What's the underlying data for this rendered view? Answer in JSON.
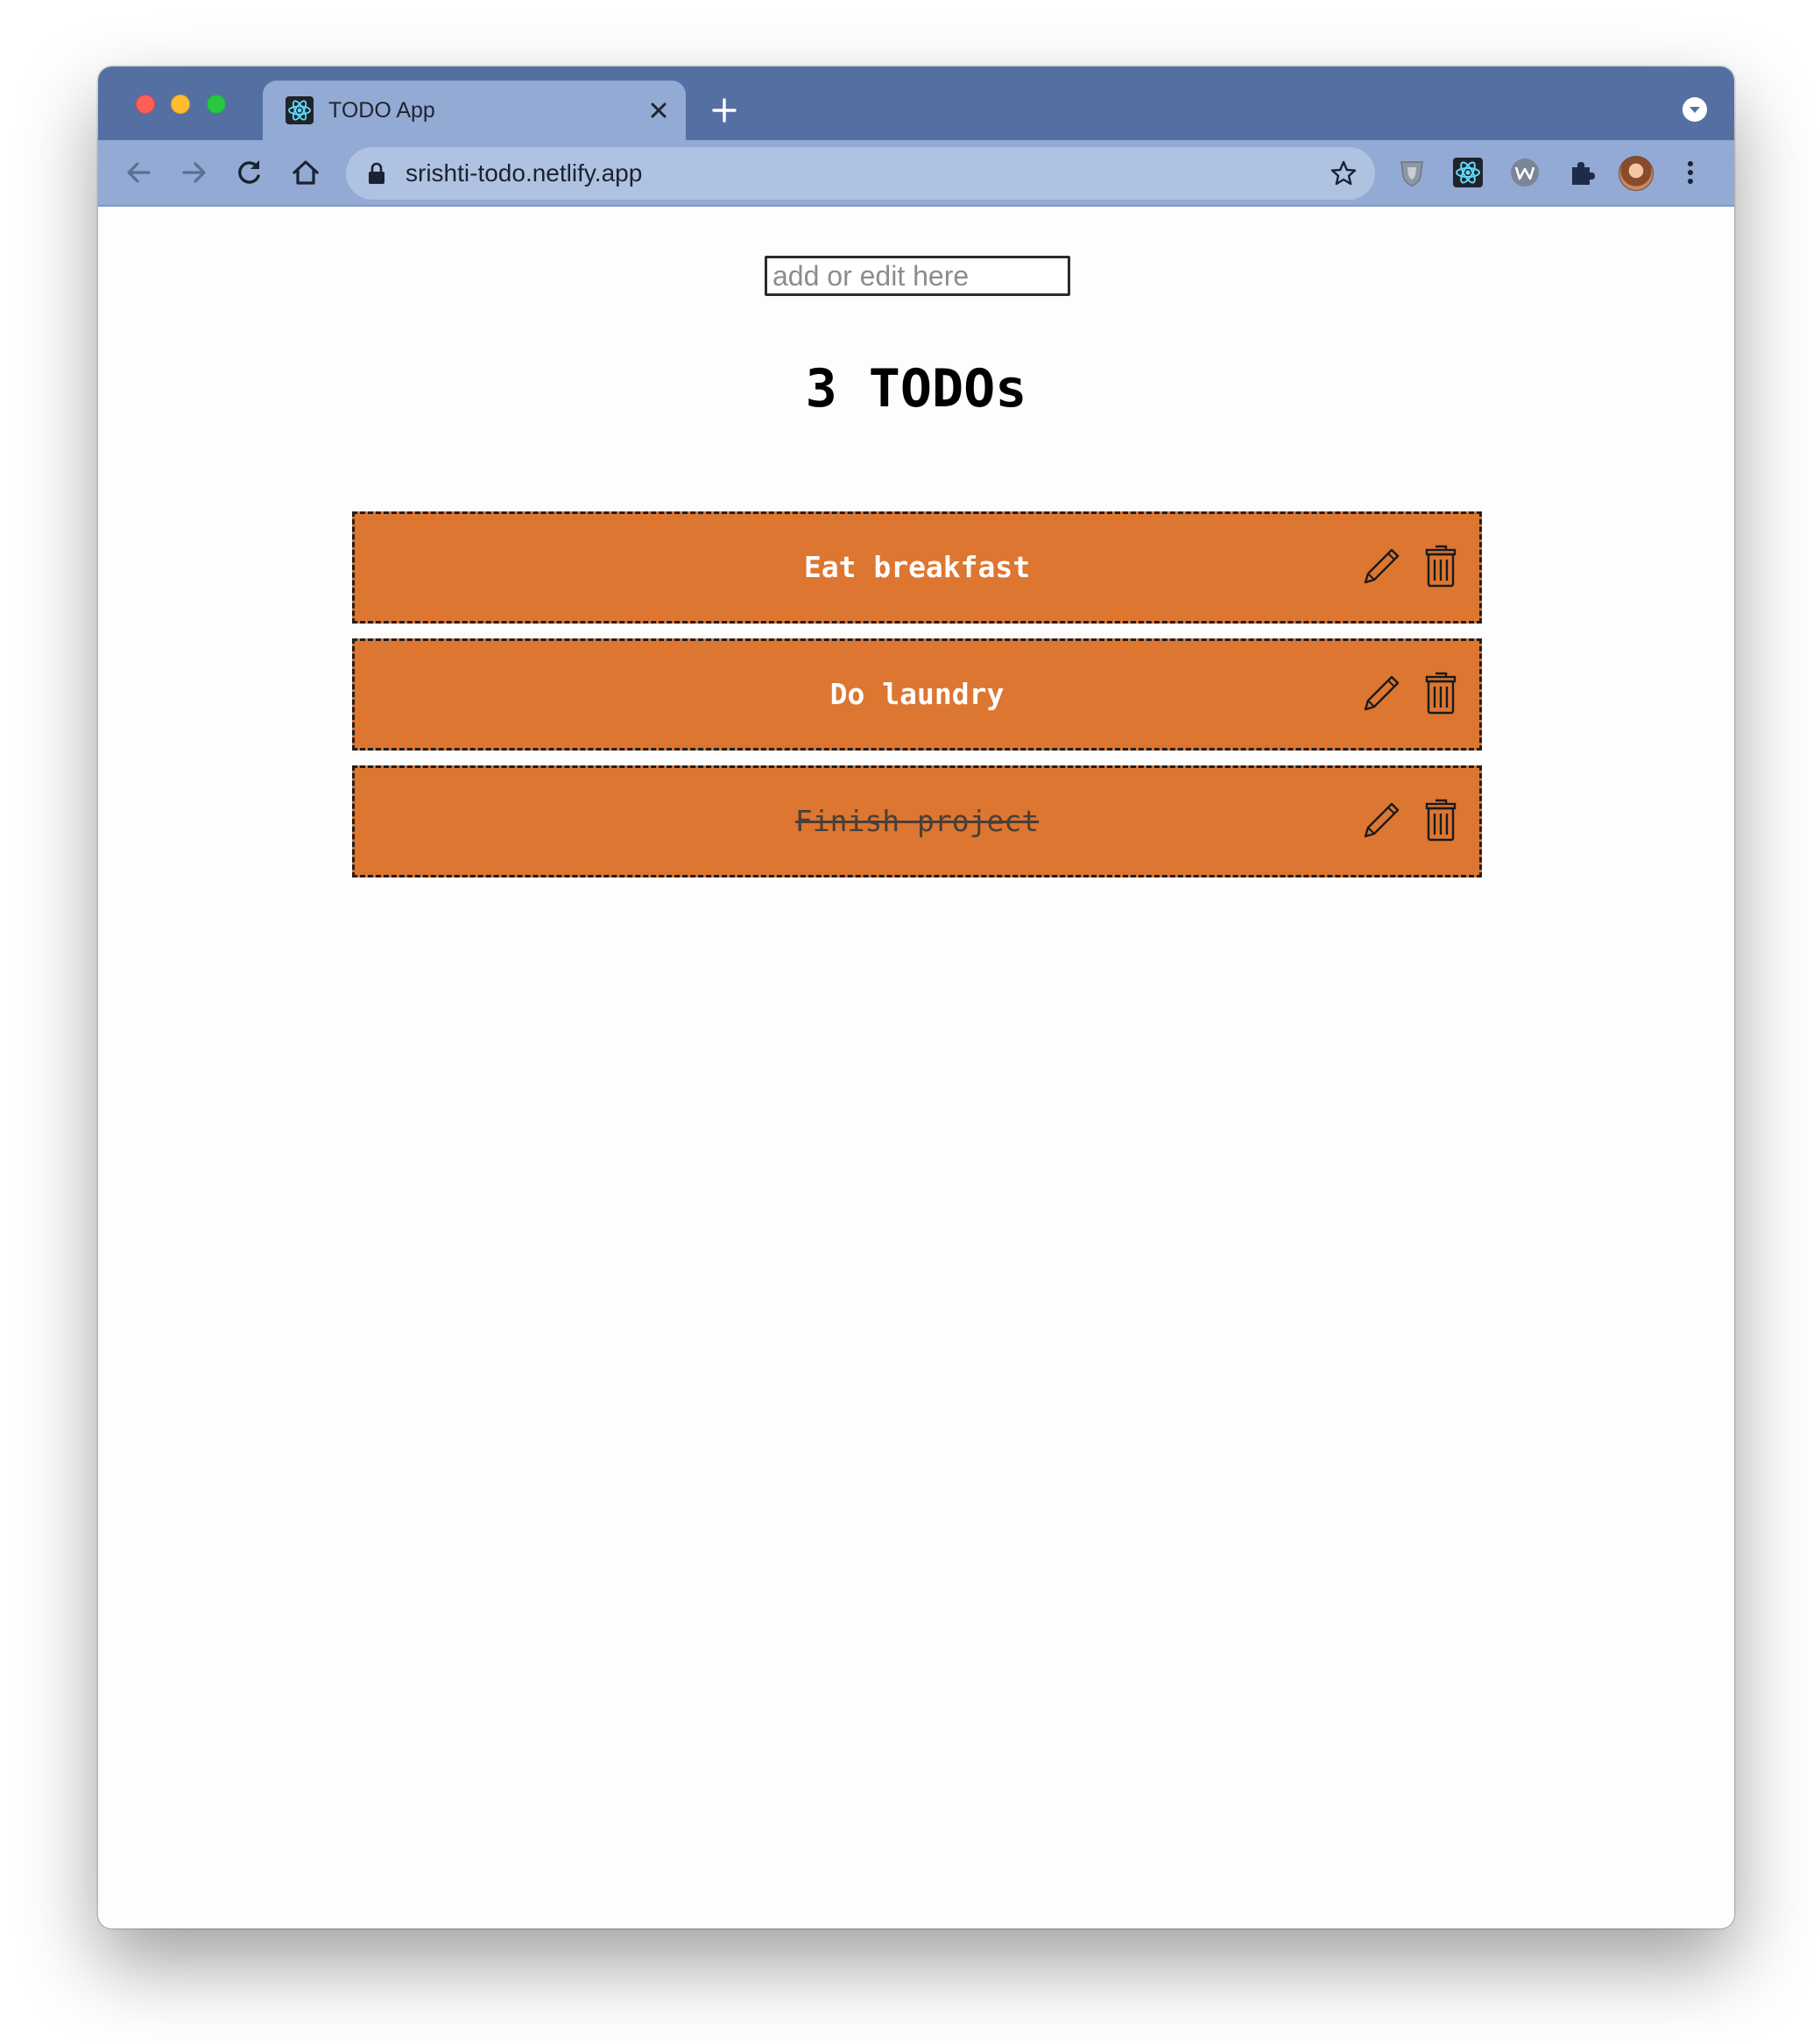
{
  "browser": {
    "tab": {
      "title": "TODO App",
      "favicon": "react-icon"
    },
    "address_bar": {
      "url": "srishti-todo.netlify.app"
    },
    "extensions": [
      "shield-extension-icon",
      "react-devtools-icon",
      "wappalyzer-icon",
      "puzzle-extensions-icon"
    ]
  },
  "app": {
    "input": {
      "placeholder": "add or edit here",
      "value": ""
    },
    "heading": "3 TODOs",
    "todos": [
      {
        "text": "Eat breakfast",
        "completed": false
      },
      {
        "text": "Do laundry",
        "completed": false
      },
      {
        "text": "Finish project",
        "completed": true
      }
    ]
  },
  "colors": {
    "chrome_frame": "#5470a3",
    "chrome_toolbar": "#92aad4",
    "todo_background": "#dc7631",
    "todo_text": "#ffffff"
  }
}
